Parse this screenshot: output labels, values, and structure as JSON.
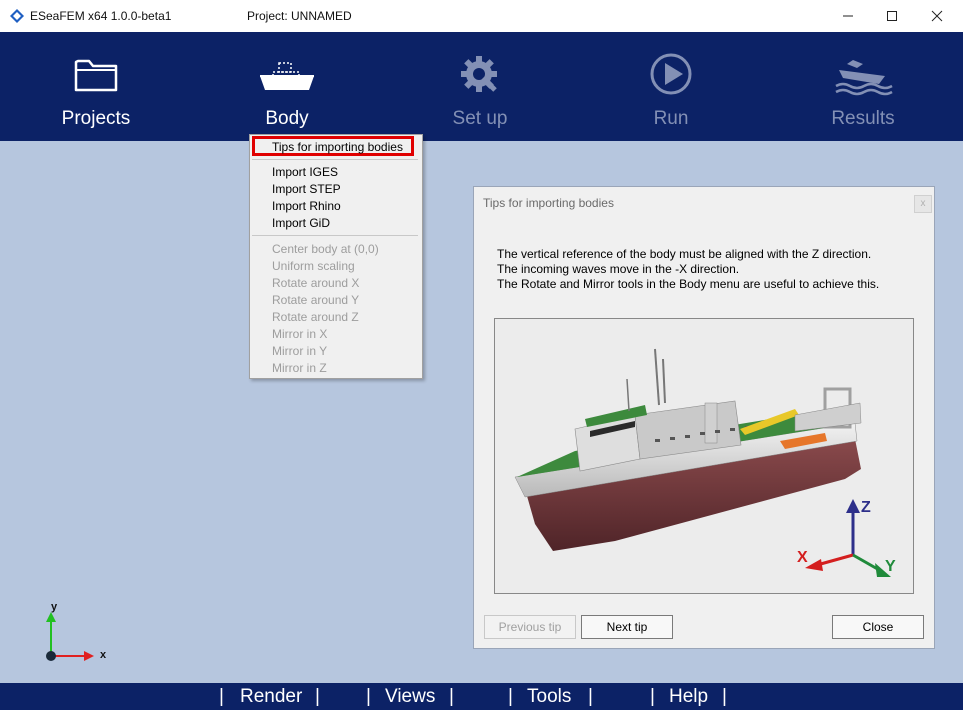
{
  "titlebar": {
    "app_name": "ESeaFEM x64 1.0.0-beta1",
    "project": "Project: UNNAMED"
  },
  "ribbon": [
    {
      "label": "Projects",
      "icon": "folder-icon",
      "enabled": true
    },
    {
      "label": "Body",
      "icon": "ship-icon",
      "enabled": true
    },
    {
      "label": "Set up",
      "icon": "gear-wrench-icon",
      "enabled": false
    },
    {
      "label": "Run",
      "icon": "play-icon",
      "enabled": false
    },
    {
      "label": "Results",
      "icon": "ship-waves-icon",
      "enabled": false
    }
  ],
  "body_menu": {
    "tips": "Tips for importing bodies",
    "import": [
      "Import IGES",
      "Import STEP",
      "Import Rhino",
      "Import GiD"
    ],
    "transform": [
      "Center body at (0,0)",
      "Uniform scaling",
      "Rotate around X",
      "Rotate around Y",
      "Rotate around Z",
      "Mirror in X",
      "Mirror in Y",
      "Mirror in Z"
    ]
  },
  "dialog": {
    "title": "Tips for importing bodies",
    "close_glyph": "x",
    "lines": [
      "The vertical reference of the body must be aligned with the Z direction.",
      "The incoming waves move in the -X direction.",
      "The Rotate and Mirror tools in the Body menu are useful to achieve this."
    ],
    "axes": {
      "x": "X",
      "y": "Y",
      "z": "Z"
    },
    "buttons": {
      "previous": "Previous tip",
      "next": "Next tip",
      "close": "Close"
    }
  },
  "triad": {
    "x": "x",
    "y": "y"
  },
  "bottombar": {
    "items": [
      "Render",
      "Views",
      "Tools",
      "Help"
    ],
    "separator": "|"
  },
  "colors": {
    "ribbon_bg": "#0c2266",
    "viewport_bg": "#b6c6de",
    "highlight": "#e00000"
  }
}
